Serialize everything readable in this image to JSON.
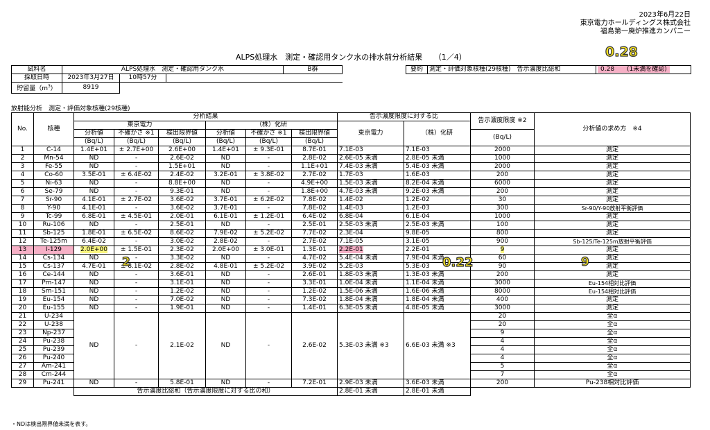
{
  "header": {
    "date": "2023年6月22日",
    "company": "東京電力ホールディングス株式会社",
    "division": "福島第一廃炉推進カンパニー"
  },
  "title": "ALPS処理水　測定・確認用タンク水の排水前分析結果　　（1／4）",
  "annotations": {
    "total": "0.28",
    "i129_value": "2",
    "i129_ratio": "0.22",
    "i129_limit": "9"
  },
  "sample": {
    "name_label": "試料名",
    "name": "ALPS処理水　測定・確認用タンク水",
    "group": "B群",
    "date_label": "採取日時",
    "date": "2023年3月27日",
    "time": "10時57分",
    "vol_label": "貯留量（m",
    "vol_sup": "3",
    "vol_close": "）",
    "vol": "8919"
  },
  "summary": {
    "label": "要約",
    "desc": "測定・評価対象核種(29核種)　告示濃度比総和",
    "value": "0.28　　(1未満を確認)"
  },
  "section_title": "放射能分析　測定・評価対象核種(29核種)",
  "headers": {
    "no": "No.",
    "nuclide": "核種",
    "results": "分析結果",
    "tepco": "東京電力",
    "kaken": "（株）化研",
    "value": "分析値",
    "uncert": "不確かさ ※1",
    "limit": "検出限界値",
    "unit": "(Bq/L)",
    "ratio": "告示濃度限度に対する比",
    "r_tepco": "東京電力",
    "r_kaken": "（株）化研",
    "conc_limit": "告示濃度限度 ※2",
    "method": "分析値の求め方　※4"
  },
  "rows": [
    [
      "1",
      "C-14",
      "1.4E+01",
      "± 2.7E+00",
      "2.6E+00",
      "1.4E+01",
      "± 9.3E-01",
      "8.7E-01",
      "7.1E-03",
      "7.1E-03",
      "2000",
      "測定"
    ],
    [
      "2",
      "Mn-54",
      "ND",
      "-",
      "2.6E-02",
      "ND",
      "-",
      "2.8E-02",
      "2.6E-05 未満",
      "2.8E-05 未満",
      "1000",
      "測定"
    ],
    [
      "3",
      "Fe-55",
      "ND",
      "-",
      "1.5E+01",
      "ND",
      "-",
      "1.1E+01",
      "7.4E-03 未満",
      "5.4E-03 未満",
      "2000",
      "測定"
    ],
    [
      "4",
      "Co-60",
      "3.5E-01",
      "± 6.4E-02",
      "2.4E-02",
      "3.2E-01",
      "± 3.8E-02",
      "2.7E-02",
      "1.7E-03",
      "1.6E-03",
      "200",
      "測定"
    ],
    [
      "5",
      "Ni-63",
      "ND",
      "-",
      "8.8E+00",
      "ND",
      "-",
      "4.9E+00",
      "1.5E-03 未満",
      "8.2E-04 未満",
      "6000",
      "測定"
    ],
    [
      "6",
      "Se-79",
      "ND",
      "-",
      "9.3E-01",
      "ND",
      "-",
      "1.8E+00",
      "4.7E-03 未満",
      "9.2E-03 未満",
      "200",
      "測定"
    ],
    [
      "7",
      "Sr-90",
      "4.1E-01",
      "± 2.7E-02",
      "3.6E-02",
      "3.7E-01",
      "± 6.2E-02",
      "7.8E-02",
      "1.4E-02",
      "1.2E-02",
      "30",
      "測定"
    ],
    [
      "8",
      "Y-90",
      "4.1E-01",
      "-",
      "3.6E-02",
      "3.7E-01",
      "-",
      "7.8E-02",
      "1.4E-03",
      "1.2E-03",
      "300",
      "Sr-90/Y-90放射平衡評価"
    ],
    [
      "9",
      "Tc-99",
      "6.8E-01",
      "± 4.5E-01",
      "2.0E-01",
      "6.1E-01",
      "± 1.2E-01",
      "6.4E-02",
      "6.8E-04",
      "6.1E-04",
      "1000",
      "測定"
    ],
    [
      "10",
      "Ru-106",
      "ND",
      "-",
      "2.5E-01",
      "ND",
      "-",
      "2.5E-01",
      "2.5E-03 未満",
      "2.5E-03 未満",
      "100",
      "測定"
    ],
    [
      "11",
      "Sb-125",
      "1.8E-01",
      "± 6.5E-02",
      "8.6E-02",
      "7.9E-02",
      "± 5.2E-02",
      "7.7E-02",
      "2.3E-04",
      "9.8E-05",
      "800",
      "測定"
    ],
    [
      "12",
      "Te-125m",
      "6.4E-02",
      "-",
      "3.0E-02",
      "2.8E-02",
      "-",
      "2.7E-02",
      "7.1E-05",
      "3.1E-05",
      "900",
      "Sb-125/Te-125m放射平衡評価"
    ],
    [
      "13",
      "I-129",
      "2.0E+00",
      "± 1.5E-01",
      "2.3E-02",
      "2.0E+00",
      "± 3.0E-01",
      "1.3E-01",
      "2.2E-01",
      "2.2E-01",
      "9",
      "測定"
    ],
    [
      "14",
      "Cs-134",
      "ND",
      "-",
      "3.3E-02",
      "ND",
      "-",
      "4.7E-02",
      "5.4E-04 未満",
      "7.9E-04 未満",
      "60",
      "測定"
    ],
    [
      "15",
      "Cs-137",
      "4.7E-01",
      "± 8.1E-02",
      "2.8E-02",
      "4.8E-01",
      "± 5.2E-02",
      "3.9E-02",
      "5.2E-03",
      "5.3E-03",
      "90",
      "測定"
    ],
    [
      "16",
      "Ce-144",
      "ND",
      "-",
      "3.6E-01",
      "ND",
      "-",
      "2.6E-01",
      "1.8E-03 未満",
      "1.3E-03 未満",
      "200",
      "測定"
    ],
    [
      "17",
      "Pm-147",
      "ND",
      "-",
      "3.1E-01",
      "ND",
      "-",
      "3.3E-01",
      "1.0E-04 未満",
      "1.1E-04 未満",
      "3000",
      "Eu-154相対比評価"
    ],
    [
      "18",
      "Sm-151",
      "ND",
      "-",
      "1.2E-02",
      "ND",
      "-",
      "1.2E-02",
      "1.5E-06 未満",
      "1.6E-06 未満",
      "8000",
      "Eu-154相対比評価"
    ],
    [
      "19",
      "Eu-154",
      "ND",
      "-",
      "7.0E-02",
      "ND",
      "-",
      "7.3E-02",
      "1.8E-04 未満",
      "1.8E-04 未満",
      "400",
      "測定"
    ],
    [
      "20",
      "Eu-155",
      "ND",
      "-",
      "1.9E-01",
      "ND",
      "-",
      "1.4E-01",
      "6.3E-05 未満",
      "4.8E-05 未満",
      "3000",
      "測定"
    ]
  ],
  "group_rows": [
    [
      "21",
      "U-234",
      "20",
      "全α"
    ],
    [
      "22",
      "U-238",
      "20",
      "全α"
    ],
    [
      "23",
      "Np-237",
      "9",
      "全α"
    ],
    [
      "24",
      "Pu-238",
      "4",
      "全α"
    ],
    [
      "25",
      "Pu-239",
      "4",
      "全α"
    ],
    [
      "26",
      "Pu-240",
      "4",
      "全α"
    ],
    [
      "27",
      "Am-241",
      "5",
      "全α"
    ],
    [
      "28",
      "Cm-244",
      "7",
      "全α"
    ]
  ],
  "group_values": {
    "v1": "ND",
    "u1": "-",
    "d1": "2.1E-02",
    "v2": "ND",
    "u2": "-",
    "d2": "2.6E-02",
    "r1": "5.3E-03 未満 ※3",
    "r2": "6.6E-03 未満 ※3"
  },
  "last_row": [
    "29",
    "Pu-241",
    "ND",
    "-",
    "5.8E-01",
    "ND",
    "-",
    "7.2E-01",
    "2.9E-03 未満",
    "3.6E-03 未満",
    "200",
    "Pu-238相対比評価"
  ],
  "total_row": {
    "label": "告示濃度比総和（告示濃度限度に対する比の和）",
    "r1": "2.8E-01 未満",
    "r2": "2.8E-01 未満"
  },
  "footnote": "・NDは検出限界値未満を表す。"
}
